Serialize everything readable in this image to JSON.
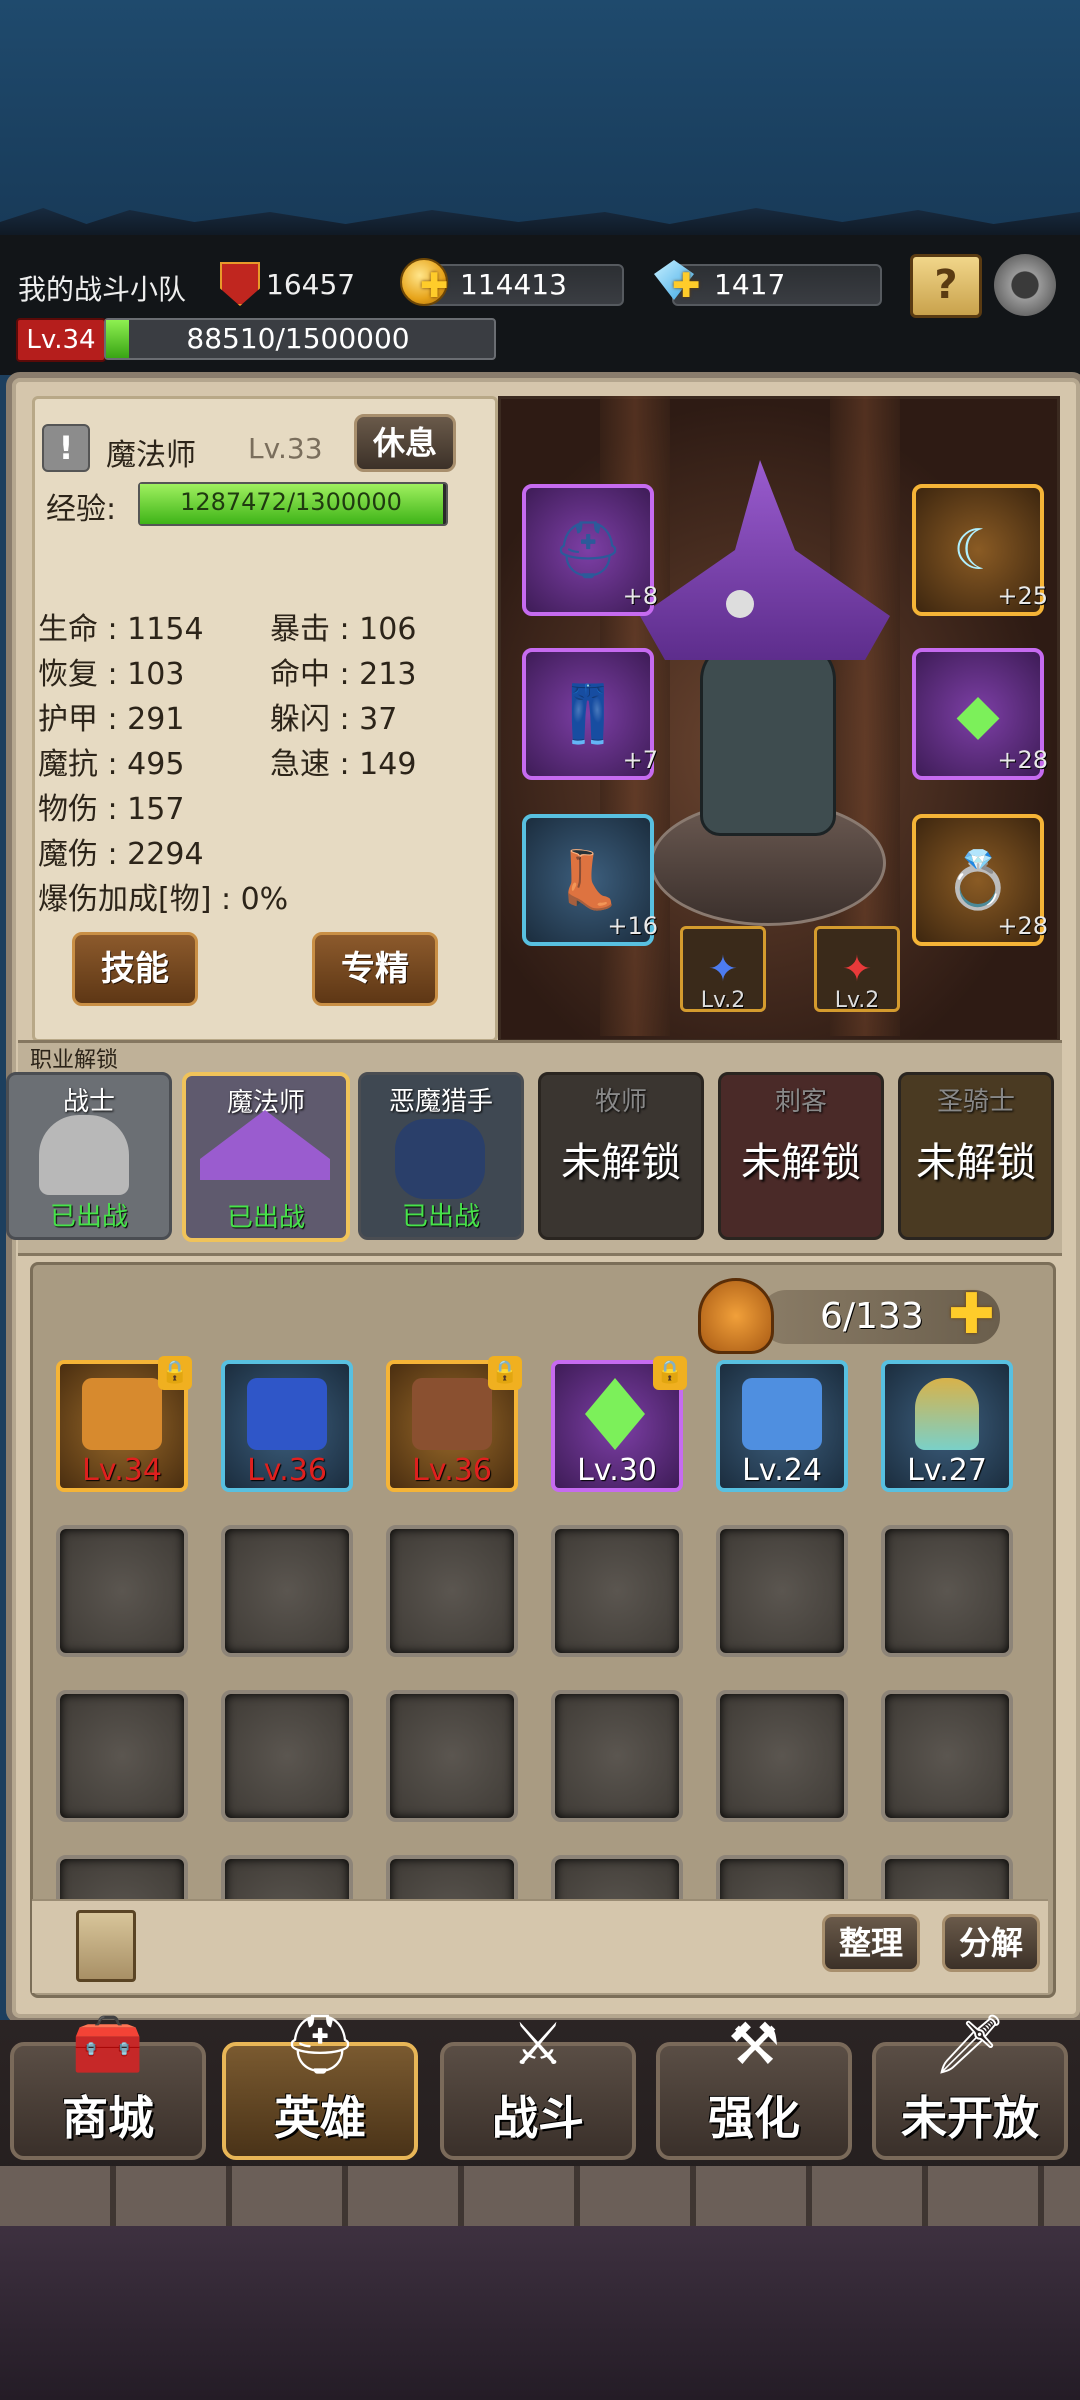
{
  "header": {
    "team_name": "我的战斗小队",
    "power": "16457",
    "gold": "114413",
    "diamonds": "1417",
    "player_level": "Lv.34",
    "player_exp": "88510/1500000",
    "player_exp_fraction": 0.059
  },
  "hero": {
    "class_name": "魔法师",
    "level": "Lv.33",
    "rest_button": "休息",
    "exp_label": "经验:",
    "exp_value": "1287472/1300000",
    "exp_fraction": 0.99,
    "stats_left": [
      "生命 : 1154",
      "恢复 : 103",
      "护甲 : 291",
      "魔抗 : 495",
      "物伤 : 157",
      "魔伤 : 2294",
      "爆伤加成[物] : 0%"
    ],
    "stats_right": [
      "暴击 : 106",
      "命中 : 213",
      "躲闪 : 37",
      "急速 : 149"
    ],
    "skill_button": "技能",
    "mastery_button": "专精"
  },
  "equipment": {
    "helmet_plus": "+8",
    "armor_plus": "+7",
    "boots_plus": "+16",
    "weapon_plus": "+25",
    "staff_plus": "+28",
    "ring_plus": "+28",
    "gem1_level": "Lv.2",
    "gem2_level": "Lv.2"
  },
  "class_unlock": {
    "title": "职业解锁",
    "classes": [
      {
        "name": "战士",
        "status": "已出战"
      },
      {
        "name": "魔法师",
        "status": "已出战"
      },
      {
        "name": "恶魔猎手",
        "status": "已出战"
      },
      {
        "name": "牧师",
        "status": "未解锁"
      },
      {
        "name": "刺客",
        "status": "未解锁"
      },
      {
        "name": "圣骑士",
        "status": "未解锁"
      }
    ]
  },
  "inventory": {
    "capacity": "6/133",
    "items": [
      {
        "level": "Lv.34",
        "locked": true,
        "icon": "chest-armor-icon"
      },
      {
        "level": "Lv.36",
        "locked": false,
        "icon": "blue-boots-icon"
      },
      {
        "level": "Lv.36",
        "locked": true,
        "icon": "brown-boots-icon"
      },
      {
        "level": "Lv.30",
        "locked": true,
        "icon": "green-staff-icon"
      },
      {
        "level": "Lv.24",
        "locked": false,
        "icon": "blue-pants-icon"
      },
      {
        "level": "Lv.27",
        "locked": false,
        "icon": "genie-lamp-icon"
      }
    ],
    "sort_button": "整理",
    "decompose_button": "分解"
  },
  "nav": {
    "shop": "商城",
    "hero": "英雄",
    "battle": "战斗",
    "enhance": "强化",
    "locked": "未开放"
  },
  "colors": {
    "accent_gold": "#f5b437",
    "epic_purple": "#c66bf0",
    "rare_blue": "#58c0e0",
    "deployed_green": "#47e34a",
    "level_red": "#e0201e"
  }
}
